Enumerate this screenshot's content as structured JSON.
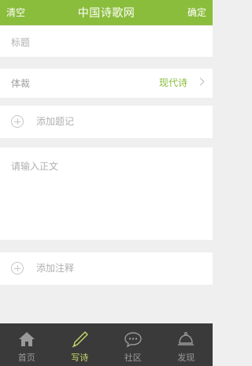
{
  "header": {
    "left_label": "清空",
    "title": "中国诗歌网",
    "right_label": "确定"
  },
  "form": {
    "title_placeholder": "标题",
    "genre_label": "体裁",
    "genre_value": "现代诗",
    "add_tag_label": "添加题记",
    "body_placeholder": "请输入正文",
    "add_note_label": "添加注释"
  },
  "tabs": [
    {
      "label": "首页",
      "icon": "home-icon"
    },
    {
      "label": "写诗",
      "icon": "pen-icon",
      "active": true
    },
    {
      "label": "社区",
      "icon": "chat-icon"
    },
    {
      "label": "发现",
      "icon": "bell-icon"
    }
  ],
  "colors": {
    "accent": "#8bbd3c",
    "tabbar": "#3a3a3a",
    "active_tab": "#c8d96a"
  }
}
